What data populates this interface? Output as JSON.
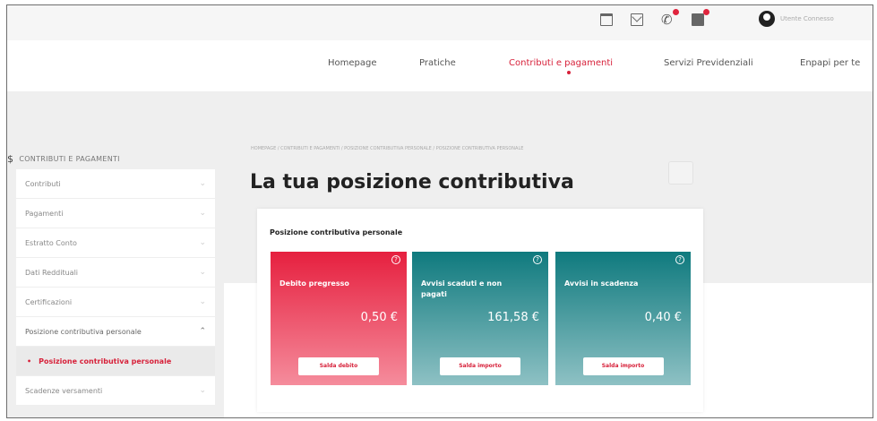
{
  "header": {
    "icons": [
      "calendar-icon",
      "mail-icon",
      "phone-icon",
      "envelope-icon"
    ],
    "username": "Utente Connesso"
  },
  "nav": {
    "items": [
      {
        "label": "Homepage"
      },
      {
        "label": "Pratiche"
      },
      {
        "label": "Contributi e pagamenti"
      },
      {
        "label": "Servizi Previdenziali"
      },
      {
        "label": "Enpapi per te"
      }
    ],
    "accent": "#d7213a"
  },
  "sidebar": {
    "section_title": "CONTRIBUTI E PAGAMENTI",
    "section_icon": "$",
    "items": [
      {
        "label": "Contributi"
      },
      {
        "label": "Pagamenti"
      },
      {
        "label": "Estratto Conto"
      },
      {
        "label": "Dati Reddituali"
      },
      {
        "label": "Certificazioni"
      },
      {
        "label": "Posizione contributiva personale"
      }
    ],
    "subitem": "Posizione contributiva personale",
    "last_item": "Scadenze versamenti"
  },
  "main": {
    "breadcrumb": "HOMEPAGE / CONTRIBUTI E PAGAMENTI / POSIZIONE CONTRIBUTIVA PERSONALE / POSIZIONE CONTRIBUTIVA PERSONALE",
    "title": "La tua posizione contributiva",
    "card_title": "Posizione contributiva personale",
    "tiles": [
      {
        "label": "Debito pregresso",
        "value": "0,50 €",
        "button": "Salda debito",
        "color": "#e6203f"
      },
      {
        "label": "Avvisi scaduti e non pagati",
        "value": "161,58 €",
        "button": "Salda importo",
        "color": "#0f7a7e"
      },
      {
        "label": "Avvisi in scadenza",
        "value": "0,40 €",
        "button": "Salda importo",
        "color": "#0f7a7e"
      }
    ],
    "help_icon": "?"
  }
}
